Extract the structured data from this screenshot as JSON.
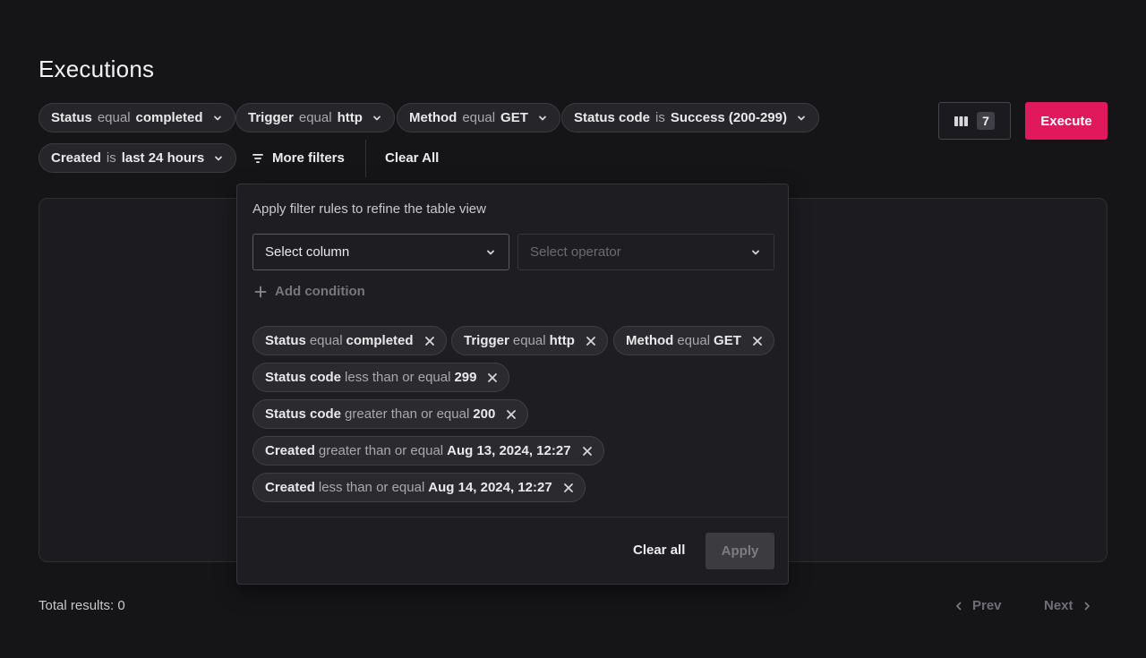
{
  "page": {
    "title": "Executions"
  },
  "active_filters": [
    {
      "field": "Status",
      "op": "equal",
      "value": "completed"
    },
    {
      "field": "Trigger",
      "op": "equal",
      "value": "http"
    },
    {
      "field": "Method",
      "op": "equal",
      "value": "GET"
    },
    {
      "field": "Status code",
      "op": "is",
      "value": "Success (200-299)"
    },
    {
      "field": "Created",
      "op": "is",
      "value": "last 24 hours"
    }
  ],
  "toolbar": {
    "more_filters_label": "More filters",
    "clear_all_label": "Clear All",
    "columns_count": "7",
    "execute_label": "Execute"
  },
  "popover": {
    "hint": "Apply filter rules to refine the table view",
    "column_placeholder": "Select column",
    "operator_placeholder": "Select operator",
    "add_condition_label": "Add condition",
    "rules": [
      {
        "field": "Status",
        "op": "equal",
        "value": "completed"
      },
      {
        "field": "Trigger",
        "op": "equal",
        "value": "http"
      },
      {
        "field": "Method",
        "op": "equal",
        "value": "GET"
      },
      {
        "field": "Status code",
        "op": "less than or equal",
        "value": "299"
      },
      {
        "field": "Status code",
        "op": "greater than or equal",
        "value": "200"
      },
      {
        "field": "Created",
        "op": "greater than or equal",
        "value": "Aug 13, 2024, 12:27"
      },
      {
        "field": "Created",
        "op": "less than or equal",
        "value": "Aug 14, 2024, 12:27"
      }
    ],
    "clear_all_label": "Clear all",
    "apply_label": "Apply"
  },
  "footer": {
    "total_results": "Total results: 0",
    "prev_label": "Prev",
    "next_label": "Next"
  },
  "colors": {
    "background": "#151518",
    "accent": "#e0195d"
  }
}
